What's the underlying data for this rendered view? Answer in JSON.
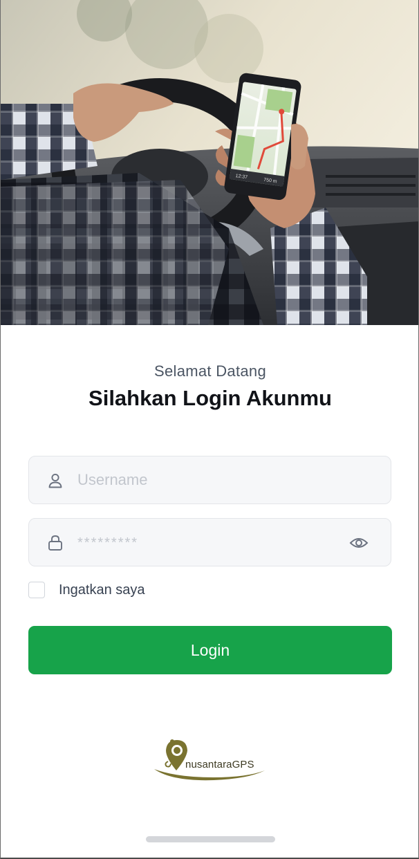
{
  "hero": {
    "icon": "driver-holding-phone-photo",
    "phone_status_left": "12:37",
    "phone_status_right": "750 m"
  },
  "header": {
    "greeting": "Selamat Datang",
    "title": "Silahkan Login Akunmu"
  },
  "form": {
    "username": {
      "value": "",
      "placeholder": "Username",
      "icon": "user-icon"
    },
    "password": {
      "value": "",
      "placeholder": "*********",
      "icon": "lock-icon",
      "toggle_icon": "eye-icon"
    },
    "remember": {
      "label": "Ingatkan saya",
      "checked": false
    },
    "submit_label": "Login"
  },
  "brand": {
    "name": "nusantaraGPS",
    "icon": "map-pin-logo-icon",
    "color": "#7a7330"
  },
  "colors": {
    "primary": "#17a34a",
    "field_bg": "#f6f7f9",
    "field_border": "#e3e5e9",
    "title": "#111318",
    "subtitle": "#4b5563"
  }
}
